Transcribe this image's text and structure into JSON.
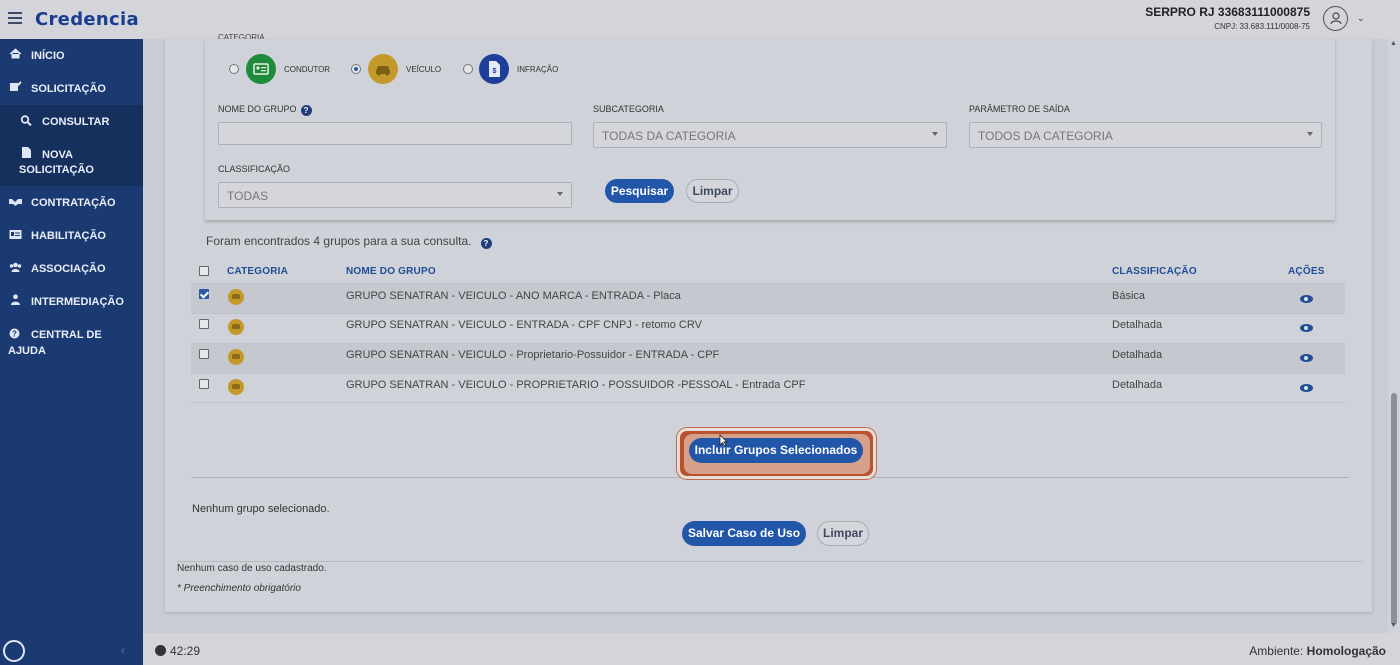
{
  "header": {
    "brand": "Credencia",
    "org_name": "SERPRO RJ 33683111000875",
    "org_cnpj": "CNPJ: 33.683.111/0008-75"
  },
  "sidebar": {
    "items": [
      {
        "label": "INÍCIO",
        "icon": "home-icon"
      },
      {
        "label": "SOLICITAÇÃO",
        "icon": "edit-icon"
      },
      {
        "label": "CONSULTAR",
        "icon": "search-icon"
      },
      {
        "label": "NOVA SOLICITAÇÃO",
        "line1": "NOVA",
        "line2": "SOLICITAÇÃO",
        "icon": "document-icon"
      },
      {
        "label": "CONTRATAÇÃO",
        "icon": "handshake-icon"
      },
      {
        "label": "HABILITAÇÃO",
        "icon": "id-card-icon"
      },
      {
        "label": "ASSOCIAÇÃO",
        "icon": "users-icon"
      },
      {
        "label": "INTERMEDIAÇÃO",
        "icon": "user-tie-icon"
      },
      {
        "label": "CENTRAL DE AJUDA",
        "line1": "CENTRAL DE",
        "line2": "AJUDA",
        "icon": "question-icon"
      }
    ]
  },
  "filters": {
    "categoria_label": "CATEGORIA",
    "categories": [
      {
        "label": "CONDUTOR",
        "selected": false,
        "color": "#1f8a3a"
      },
      {
        "label": "VEÍCULO",
        "selected": true,
        "color": "#c39a2a"
      },
      {
        "label": "INFRAÇÃO",
        "selected": false,
        "color": "#1d3f9a"
      }
    ],
    "nome_grupo_label": "NOME DO GRUPO",
    "nome_grupo_value": "",
    "subcategoria_label": "SUBCATEGORIA",
    "subcategoria_value": "TODAS DA CATEGORIA",
    "parametro_label": "PARÂMETRO DE SAÍDA",
    "parametro_value": "TODOS DA CATEGORIA",
    "classificacao_label": "CLASSIFICAÇÃO",
    "classificacao_value": "TODAS",
    "search_button": "Pesquisar",
    "clear_button": "Limpar"
  },
  "results": {
    "summary": "Foram encontrados 4 grupos para a sua consulta.",
    "columns": [
      "CATEGORIA",
      "NOME DO GRUPO",
      "CLASSIFICAÇÃO",
      "AÇÕES"
    ],
    "rows": [
      {
        "checked": true,
        "name": "GRUPO SENATRAN - VEICULO - ANO MARCA - ENTRADA - Placa",
        "classification": "Básica"
      },
      {
        "checked": false,
        "name": "GRUPO SENATRAN - VEICULO - ENTRADA - CPF CNPJ - retomo CRV",
        "classification": "Detalhada"
      },
      {
        "checked": false,
        "name": "GRUPO SENATRAN - VEICULO - Proprietario-Possuidor - ENTRADA - CPF",
        "classification": "Detalhada"
      },
      {
        "checked": false,
        "name": "GRUPO SENATRAN - VEICULO - PROPRIETARIO - POSSUIDOR -PESSOAL - Entrada CPF",
        "classification": "Detalhada"
      }
    ],
    "include_button": "Incluir Grupos Selecionados"
  },
  "selection": {
    "none_selected": "Nenhum grupo selecionado.",
    "save_button": "Salvar Caso de Uso",
    "clear_button": "Limpar"
  },
  "notes": {
    "no_use_case": "Nenhum caso de uso cadastrado.",
    "required": "* Preenchimento obrigatório"
  },
  "footer": {
    "timer": "42:29",
    "ambiente_label": "Ambiente:",
    "ambiente_value": "Homologação"
  },
  "colors": {
    "sidebar": "#1b3a72",
    "primary": "#2256a8",
    "highlight": "#b9532f"
  }
}
